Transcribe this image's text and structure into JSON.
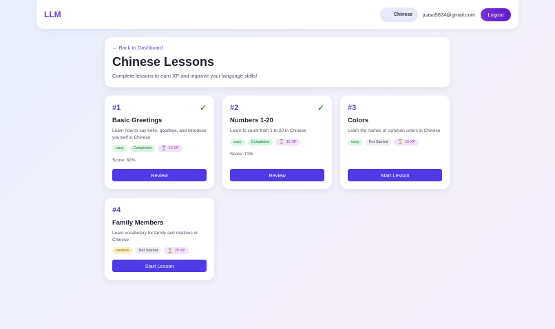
{
  "nav": {
    "brand": "LLM",
    "language": "Chinese",
    "email": "jcaso5624@gmail.com",
    "logout_label": "Logout"
  },
  "header": {
    "back_label": "← Back to Dashboard",
    "title": "Chinese Lessons",
    "subtitle": "Complete lessons to earn XP and improve your language skills!"
  },
  "lessons": [
    {
      "number": "#1",
      "title": "Basic Greetings",
      "description": "Learn how to say hello, goodbye, and introduce yourself in Chinese",
      "difficulty": "easy",
      "status": "Completed",
      "xp": "10 XP",
      "score": "Score: 82%",
      "button": "Review",
      "completed": true
    },
    {
      "number": "#2",
      "title": "Numbers 1-20",
      "description": "Learn to count from 1 to 20 in Chinese",
      "difficulty": "easy",
      "status": "Completed",
      "xp": "15 XP",
      "score": "Score: 71%",
      "button": "Review",
      "completed": true
    },
    {
      "number": "#3",
      "title": "Colors",
      "description": "Learn the names of common colors in Chinese",
      "difficulty": "easy",
      "status": "Not Started",
      "xp": "10 XP",
      "button": "Start Lesson",
      "completed": false
    },
    {
      "number": "#4",
      "title": "Family Members",
      "description": "Learn vocabulary for family and relatives in Chinese",
      "difficulty": "medium",
      "status": "Not Started",
      "xp": "20 XP",
      "button": "Start Lesson",
      "completed": false
    }
  ],
  "icons": {
    "completed": "checkmark-icon",
    "xp": "xp-icon"
  },
  "colors": {
    "accent": "#4f3ae6",
    "brand": "#6b3fe0",
    "success": "#22a44a"
  }
}
